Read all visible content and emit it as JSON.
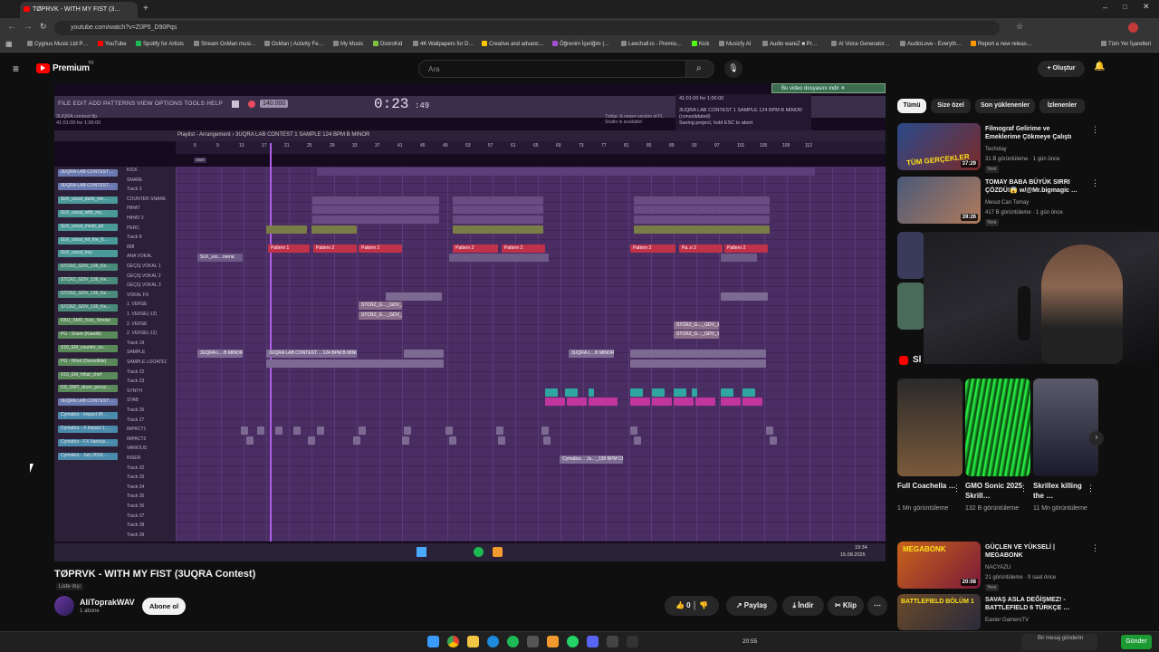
{
  "browser": {
    "tab_title": "TØPRVK - WITH MY FIST (3…",
    "url": "youtube.com/watch?v=Z0P5_D90Pqs",
    "all_bookmarks": "Tüm Yer İşaretleri",
    "bookmarks": [
      "Cygnus Music Ltd P…",
      "YouTube",
      "Spotify for Artists",
      "Stream OsMan musi…",
      "OsMan | Activity Fe…",
      "My Music",
      "DistroKid",
      "4K Wallpapers for D…",
      "Creative and advanc…",
      "Öğrenim İçeriğim |…",
      "Leechall.io - Premiu…",
      "Kick",
      "Musicfy AI",
      "Audio wareZ ■ Pr…",
      "AI Voice Generator…",
      "AudioLove - Everyth…",
      "Report a new releas…"
    ]
  },
  "youtube": {
    "logo": "Premium",
    "logo_sup": "TR",
    "search_placeholder": "Ara",
    "create_label": "Oluştur",
    "chips": [
      "Tümü",
      "Size özel",
      "Son yüklenenler",
      "İzlenenler"
    ],
    "video_title": "TØPRVK - WITH MY FIST (3UQRA Contest)",
    "unlisted": "Liste dışı",
    "channel_name": "AliToprakWAV",
    "subs": "1 abone",
    "subscribe": "Abone ol",
    "likes": "0",
    "share": "Paylaş",
    "download": "İndir",
    "clip": "Klip",
    "download_hint": "Bu video dosyasını indir",
    "shorts_icon_text": "Sl",
    "side_videos": [
      {
        "title": "Filmograf Gelirime ve Emeklerime Çökmeye Çalıştı",
        "channel": "Techolay",
        "meta": "31 B görüntüleme · 1 gün önce",
        "badge": "Yeni",
        "duration": "37:29",
        "thumb_text": "TÜM GERÇEKLER"
      },
      {
        "title": "TOMAY BABA BÜYÜK SIRRI ÇÖZDÜ!😱 w/@Mr.bigmagic …",
        "channel": "Mesut Can Tomay",
        "meta": "417 B görüntüleme · 1 gün önce",
        "badge": "Yeni",
        "duration": "39:26",
        "thumb_text": ""
      },
      {
        "title": "GÜÇLEN VE YÜKSELİ | MEGABONK",
        "channel": "NACYAZU",
        "meta": "21 görüntüleme · 9 saat önce",
        "badge": "Yeni",
        "duration": "20:08",
        "thumb_text": "MEGABONK"
      },
      {
        "title": "SAVAŞ ASLA DEĞİŞMEZ! - BATTLEFIELD 6 TÜRKÇE …",
        "channel": "Easter GamersTV",
        "meta": "",
        "badge": "",
        "duration": "",
        "thumb_text": "BATTLEFIELD BÖLÜM 1"
      }
    ],
    "shorts": [
      {
        "title": "Full Coachella …",
        "views": "1 Mn görüntüleme"
      },
      {
        "title": "GMO Sonic 2025 Skrill…",
        "views": "132 B görüntüleme"
      },
      {
        "title": "Skrillex killing the …",
        "views": "11 Mn görüntüleme"
      }
    ]
  },
  "fl": {
    "menu": "FILE EDIT ADD PATTERNS VIEW OPTIONS TOOLS HELP",
    "time": "0:23",
    "time_sub": ":49",
    "project": "3UQRA contest.flp",
    "project_time": "41:01:00 for 1:00:00",
    "tempo": "140.000",
    "hint_time": "41:01:00 for 1:00:00",
    "hint_text": "3UQRA LAB CONTEST 1 SAMPLE 124 BPM B MINOR (consolidated)",
    "hint_save": "Saving project, hold ESC to abort",
    "newer": "Tiddar: A newer version of FL Studio is available!",
    "playlist_title": "Playlist - Arrangement",
    "playlist_name": "3UQRA LAB CONTEST 1 SAMPLE 124 BPM B MINOR",
    "start_marker": "start",
    "ruler": [
      "5",
      "9",
      "13",
      "17",
      "21",
      "25",
      "29",
      "33",
      "37",
      "41",
      "45",
      "49",
      "53",
      "57",
      "61",
      "65",
      "69",
      "73",
      "77",
      "81",
      "85",
      "89",
      "93",
      "97",
      "101",
      "105",
      "109",
      "112"
    ],
    "channels": [
      "3UQRA LAB CONTEST…",
      "3UQRA LAB CONTEST…",
      "SLK_vocal_dank_me…",
      "SLK_vocal_with_my…",
      "SLK_vocal_mesh_pit",
      "SLK_vocal_hit_the_fl…",
      "SLK_vocal_hey",
      "STCRZ_GDV_136_Ke…",
      "STCRZ_GDV_136_Ke…",
      "STCRZ_GDV_136_Ke…",
      "STCRZ_GDV_136_Ke…",
      "RKU_SMD_Kick_Smoke",
      "PG - Snare (Kaadik)",
      "X10_EM_counter_sn…",
      "PG - Hihat (Dacedible)",
      "X10_EM_hihat_chef",
      "DS_DMT_drum_perca…",
      "3UQRA LAB CONTEST…",
      "Cymatics - Impact (R…",
      "Cymatics - X Impact 1…",
      "Cymatics - FX Various…",
      "Cymatics - July 2019…"
    ],
    "tracks": [
      "KICK",
      "SNARE",
      "Track 3",
      "COUNTER SNARE",
      "HIHAT",
      "HIHAT 2",
      "PERC",
      "Track 8",
      "808",
      "ANA VOKAL",
      "GEÇİŞ VOKAL 1",
      "GEÇİŞ VOKAL 2",
      "GEÇİŞ VOKAL 3",
      "VOKAL FX",
      "1. VERSE",
      "1. VERSE(-12)",
      "2. VERSE",
      "2. VERSE(-12)",
      "Track 19",
      "SAMPLE",
      "SAMPLE LOOATED",
      "Track 22",
      "Track 23",
      "SYNTH",
      "STAB",
      "Track 26",
      "Track 27",
      "IMPACT1",
      "IMPACT2",
      "VARIOUS",
      "RISER",
      "Track 32",
      "Track 33",
      "Track 34",
      "Track 35",
      "Track 36",
      "Track 37",
      "Track 38",
      "Track 39"
    ],
    "pattern1": "Pattern 1",
    "pattern2": "Pattern 2",
    "pattern2b": "Pa..n 2",
    "clip_vocal": "SLK_voc…mena",
    "clip_sample": "3UQRA L…B MINOR",
    "clip_sample_long": "3UQRA LAB CONTEST… 124 BPM B MINOR #2",
    "clip_stcrz": "STCRZ_G…_GDV_138",
    "clip_cym": "Cymatics… Ju…_130 BPM CB",
    "clock_time": "19:34",
    "clock_date": "15.08.2025"
  },
  "taskbar": {
    "time": "20:55",
    "notify": "Bir mesaj gönderin",
    "send": "Gönder"
  },
  "colors": {
    "red": "#ff0000",
    "fl_purple": "#4a2e63",
    "clip_red": "#c0314a",
    "clip_olive": "#7a7d45",
    "clip_teal": "#2fa6a0",
    "clip_pink": "#c0359e",
    "channel_green": "#5aa06a"
  }
}
